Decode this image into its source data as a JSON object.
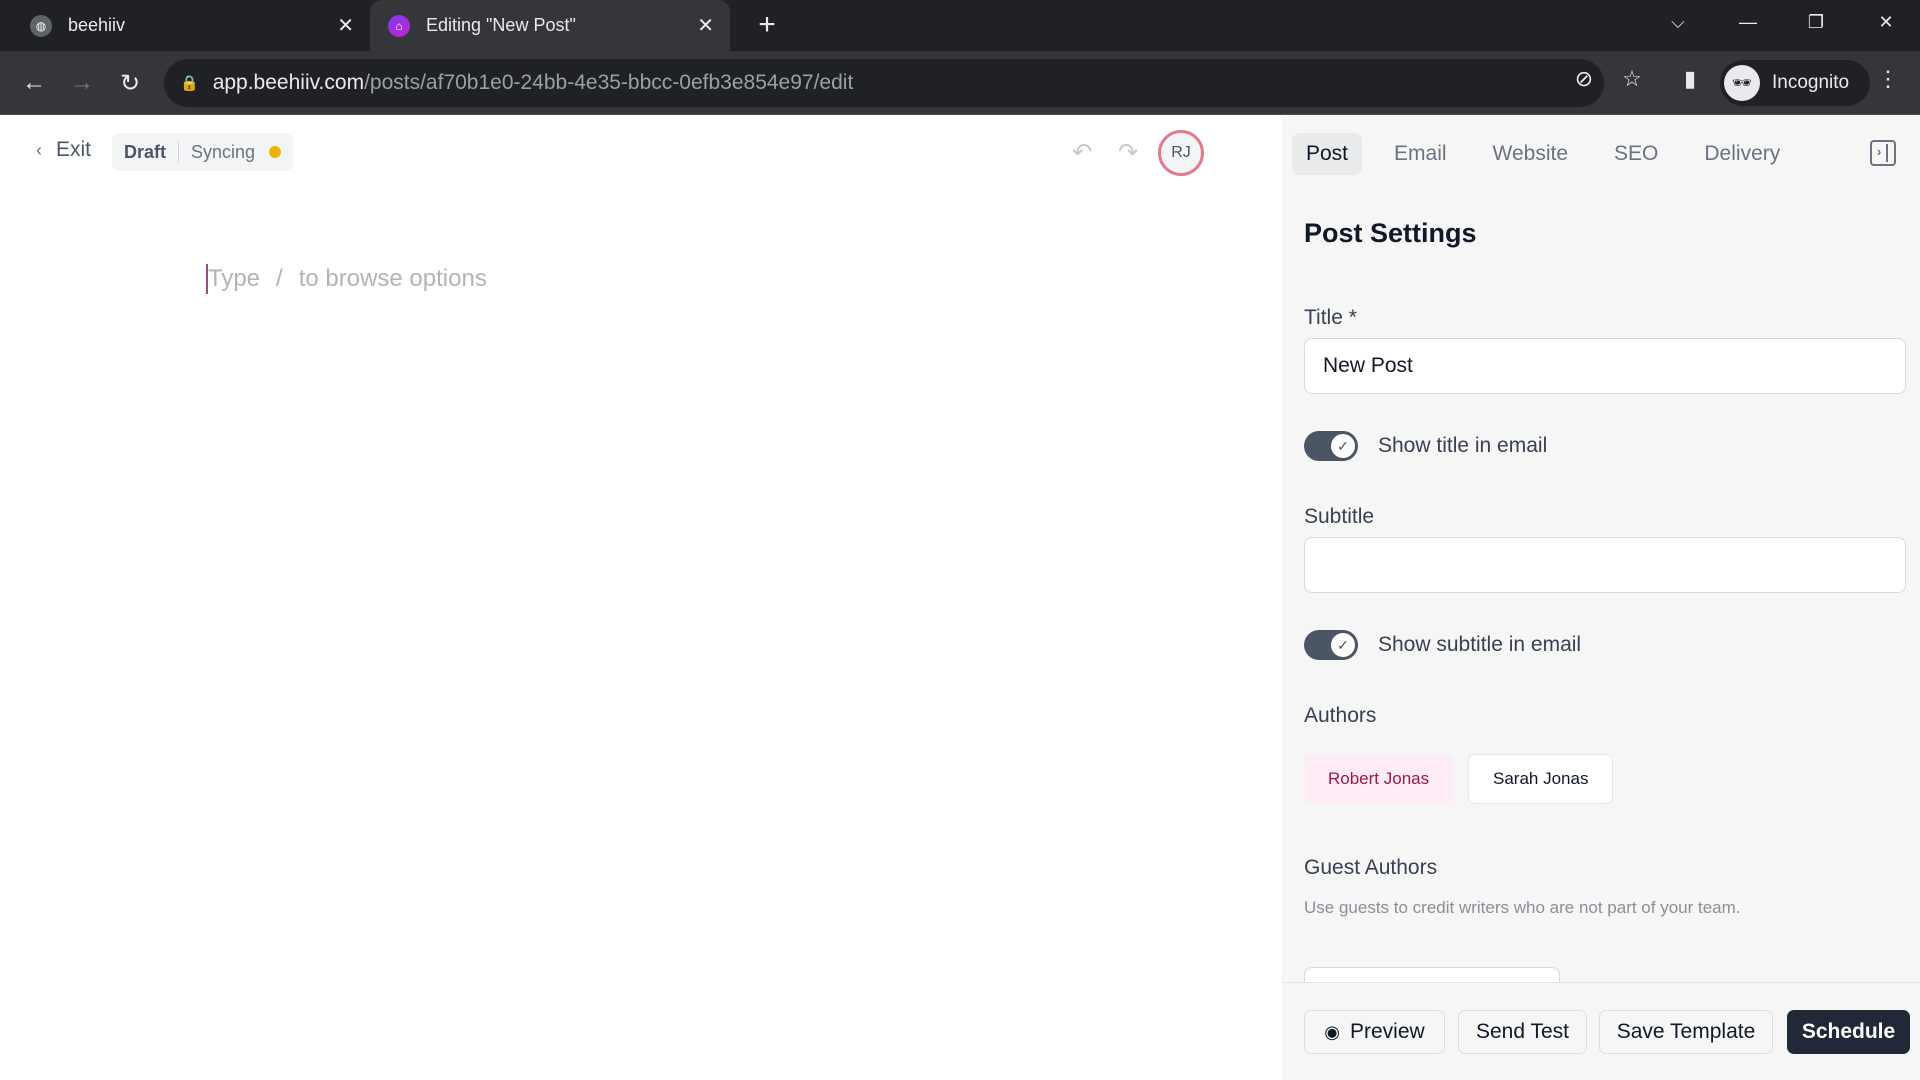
{
  "browser": {
    "tabs": [
      {
        "title": "beehiiv",
        "icon": "globe-icon",
        "active": false
      },
      {
        "title": "Editing \"New Post\"",
        "icon": "beehiiv-logo-icon",
        "active": true
      }
    ],
    "new_tab_symbol": "+",
    "close_symbol": "✕",
    "url_host": "app.beehiiv.com",
    "url_path": "/posts/af70b1e0-24bb-4e35-bbcc-0efb3e854e97/edit",
    "profile_label": "Incognito",
    "window_controls": [
      "tab-search",
      "minimize",
      "restore",
      "close"
    ]
  },
  "editor": {
    "exit_label": "Exit",
    "status_draft": "Draft",
    "status_sync": "Syncing",
    "sync_dot_color": "#eab308",
    "avatar_initials": "RJ",
    "placeholder_type": "Type",
    "placeholder_slash": "/",
    "placeholder_rest": "to browse options"
  },
  "sidebar": {
    "tabs": [
      "Post",
      "Email",
      "Website",
      "SEO",
      "Delivery"
    ],
    "active_tab": "Post",
    "heading": "Post Settings",
    "title_label": "Title *",
    "title_value": "New Post",
    "show_title_label": "Show title in email",
    "show_title_on": true,
    "subtitle_label": "Subtitle",
    "subtitle_value": "",
    "show_subtitle_label": "Show subtitle in email",
    "show_subtitle_on": true,
    "authors_label": "Authors",
    "authors": [
      {
        "name": "Robert Jonas",
        "selected": true
      },
      {
        "name": "Sarah Jonas",
        "selected": false
      }
    ],
    "guest_authors_label": "Guest Authors",
    "guest_authors_help": "Use guests to credit writers who are not part of your team."
  },
  "footer": {
    "preview_label": "Preview",
    "send_test_label": "Send Test",
    "save_template_label": "Save Template",
    "schedule_label": "Schedule"
  },
  "colors": {
    "accent_dark": "#1f2937",
    "author_selected_bg": "#fdecf5",
    "author_selected_text": "#9d174d",
    "avatar_ring": "#e17c8e"
  }
}
